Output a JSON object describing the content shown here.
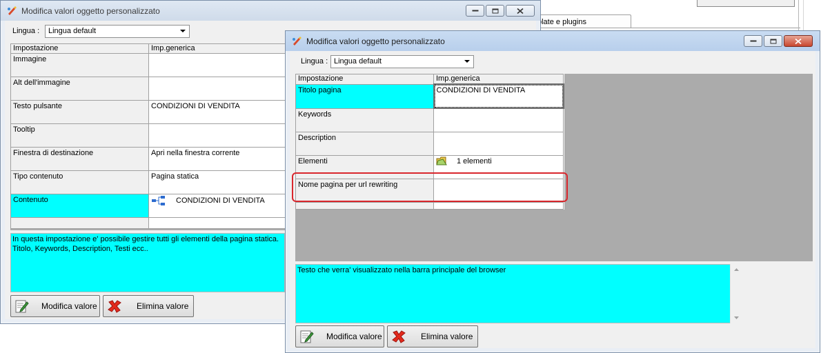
{
  "background": {
    "tab_label": "plate e plugins"
  },
  "window_back": {
    "title": "Modifica valori oggetto personalizzato",
    "language_label": "Lingua :",
    "language_value": "Lingua default",
    "columns": [
      "Impostazione",
      "Imp.generica"
    ],
    "rows": [
      {
        "setting": "Immagine",
        "value": ""
      },
      {
        "setting": "Alt dell'immagine",
        "value": ""
      },
      {
        "setting": "Testo pulsante",
        "value": "CONDIZIONI DI VENDITA"
      },
      {
        "setting": "Tooltip",
        "value": ""
      },
      {
        "setting": "Finestra di destinazione",
        "value": "Apri nella finestra corrente"
      },
      {
        "setting": "Tipo contenuto",
        "value": "Pagina statica"
      },
      {
        "setting": "Contenuto",
        "value": "CONDIZIONI DI VENDITA"
      },
      {
        "setting": "",
        "value": ""
      }
    ],
    "description": "In questa impostazione e' possibile gestire tutti gli elementi della pagina statica.\nTitolo, Keywords, Description, Testi ecc..",
    "btn_edit": "Modifica valore",
    "btn_delete": "Elimina valore"
  },
  "window_front": {
    "title": "Modifica valori oggetto personalizzato",
    "language_label": "Lingua :",
    "language_value": "Lingua default",
    "columns": [
      "Impostazione",
      "Imp.generica"
    ],
    "rows": [
      {
        "setting": "Titolo pagina",
        "value": "CONDIZIONI DI VENDITA"
      },
      {
        "setting": "Keywords",
        "value": ""
      },
      {
        "setting": "Description",
        "value": ""
      },
      {
        "setting": "Elementi",
        "value": "1 elementi"
      },
      {
        "setting": "Nome pagina per url rewriting",
        "value": ""
      }
    ],
    "description": "Testo che verra' visualizzato nella barra principale del browser",
    "btn_edit": "Modifica valore",
    "btn_delete": "Elimina valore"
  },
  "colors": {
    "selection": "#00ffff",
    "highlight": "#d9262c",
    "grid_bg": "#ababab"
  }
}
